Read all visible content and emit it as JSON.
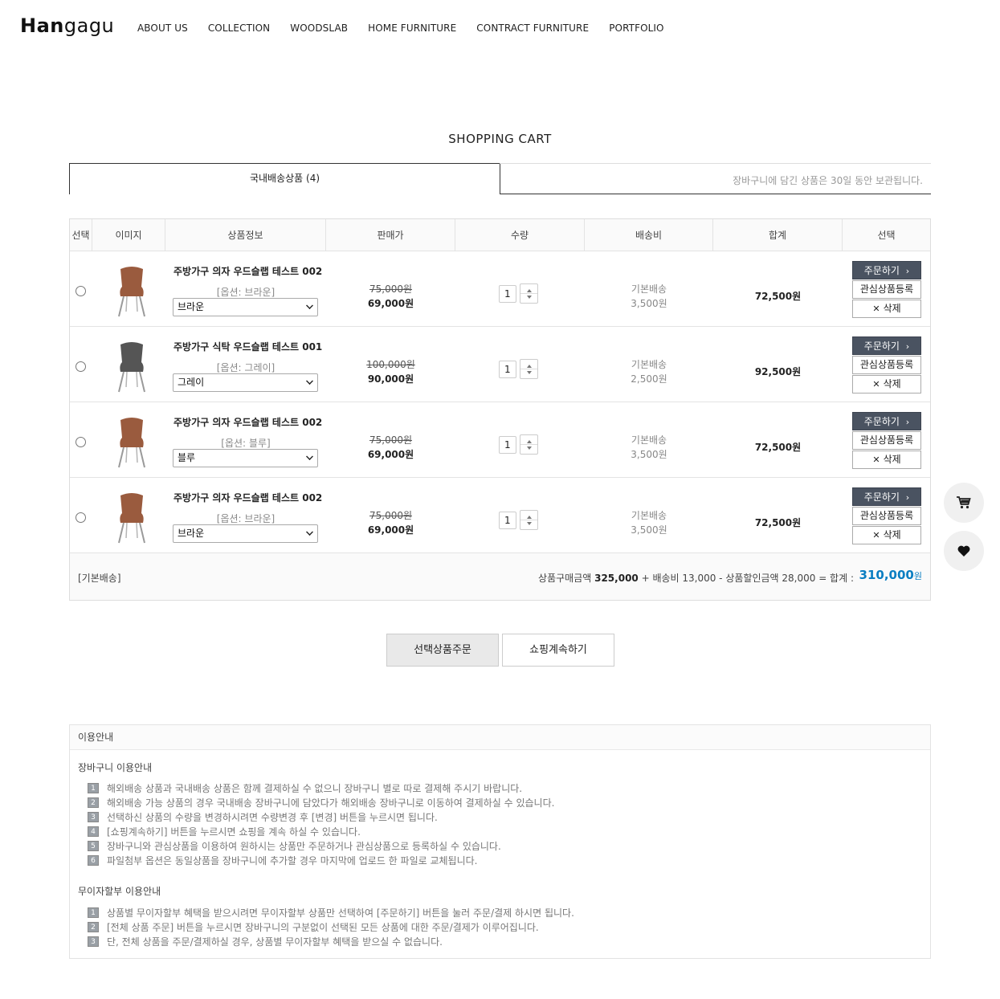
{
  "header": {
    "logo_bold": "Han",
    "logo_light": "gagu",
    "nav": [
      "ABOUT US",
      "COLLECTION",
      "WOODSLAB",
      "HOME FURNITURE",
      "CONTRACT FURNITURE",
      "PORTFOLIO"
    ]
  },
  "page_title": "SHOPPING CART",
  "tabs": {
    "active_label": "국내배송상품 (4)",
    "note": "장바구니에 담긴 상품은 30일 동안 보관됩니다."
  },
  "table": {
    "headers": [
      "선택",
      "이미지",
      "상품정보",
      "판매가",
      "수량",
      "배송비",
      "합계",
      "선택"
    ],
    "rows": [
      {
        "name": "주방가구 의자 우드슬랩 테스트 002",
        "option": "[옵션: 브라운]",
        "select": "브라운",
        "price_old": "75,000원",
        "price_new": "69,000원",
        "qty": "1",
        "ship_type": "기본배송",
        "ship_fee": "3,500원",
        "sum": "72,500원",
        "chair_color": "#9a5b3e"
      },
      {
        "name": "주방가구 식탁 우드슬랩 테스트 001",
        "option": "[옵션: 그레이]",
        "select": "그레이",
        "price_old": "100,000원",
        "price_new": "90,000원",
        "qty": "1",
        "ship_type": "기본배송",
        "ship_fee": "2,500원",
        "sum": "92,500원",
        "chair_color": "#555555"
      },
      {
        "name": "주방가구 의자 우드슬랩 테스트 002",
        "option": "[옵션: 블루]",
        "select": "블루",
        "price_old": "75,000원",
        "price_new": "69,000원",
        "qty": "1",
        "ship_type": "기본배송",
        "ship_fee": "3,500원",
        "sum": "72,500원",
        "chair_color": "#9a5b3e"
      },
      {
        "name": "주방가구 의자 우드슬랩 테스트 002",
        "option": "[옵션: 브라운]",
        "select": "브라운",
        "price_old": "75,000원",
        "price_new": "69,000원",
        "qty": "1",
        "ship_type": "기본배송",
        "ship_fee": "3,500원",
        "sum": "72,500원",
        "chair_color": "#9a5b3e"
      }
    ],
    "btn_order": "주문하기",
    "btn_wish": "관심상품등록",
    "btn_delete": "삭제",
    "footer_label": "[기본배송]",
    "footer_text_1": "상품구매금액 ",
    "footer_product_total": "325,000",
    "footer_text_2": " + 배송비 13,000 - 상품할인금액 28,000 = 합계 : ",
    "footer_total": "310,000",
    "footer_total_unit": "원"
  },
  "actions": {
    "selected_order": "선택상품주문",
    "continue_shopping": "쇼핑계속하기"
  },
  "guide": {
    "title": "이용안내",
    "cart_title": "장바구니 이용안내",
    "cart_items": [
      "해외배송 상품과 국내배송 상품은 함께 결제하실 수 없으니 장바구니 별로 따로 결제해 주시기 바랍니다.",
      "해외배송 가능 상품의 경우 국내배송 장바구니에 담았다가 해외배송 장바구니로 이동하여 결제하실 수 있습니다.",
      "선택하신 상품의 수량을 변경하시려면 수량변경 후 [변경] 버튼을 누르시면 됩니다.",
      "[쇼핑계속하기] 버튼을 누르시면 쇼핑을 계속 하실 수 있습니다.",
      "장바구니와 관심상품을 이용하여 원하시는 상품만 주문하거나 관심상품으로 등록하실 수 있습니다.",
      "파일첨부 옵션은 동일상품을 장바구니에 추가할 경우 마지막에 업로드 한 파일로 교체됩니다."
    ],
    "installment_title": "무이자할부 이용안내",
    "installment_items": [
      "상품별 무이자할부 혜택을 받으시려면 무이자할부 상품만 선택하여 [주문하기] 버튼을 눌러 주문/결제 하시면 됩니다.",
      "[전체 상품 주문] 버튼을 누르시면 장바구니의 구분없이 선택된 모든 상품에 대한 주문/결제가 이루어집니다.",
      "단, 전체 상품을 주문/결제하실 경우, 상품별 무이자할부 혜택을 받으실 수 없습니다."
    ]
  },
  "floating": {
    "cart_icon": "cart-icon",
    "wish_icon": "heart-icon"
  }
}
